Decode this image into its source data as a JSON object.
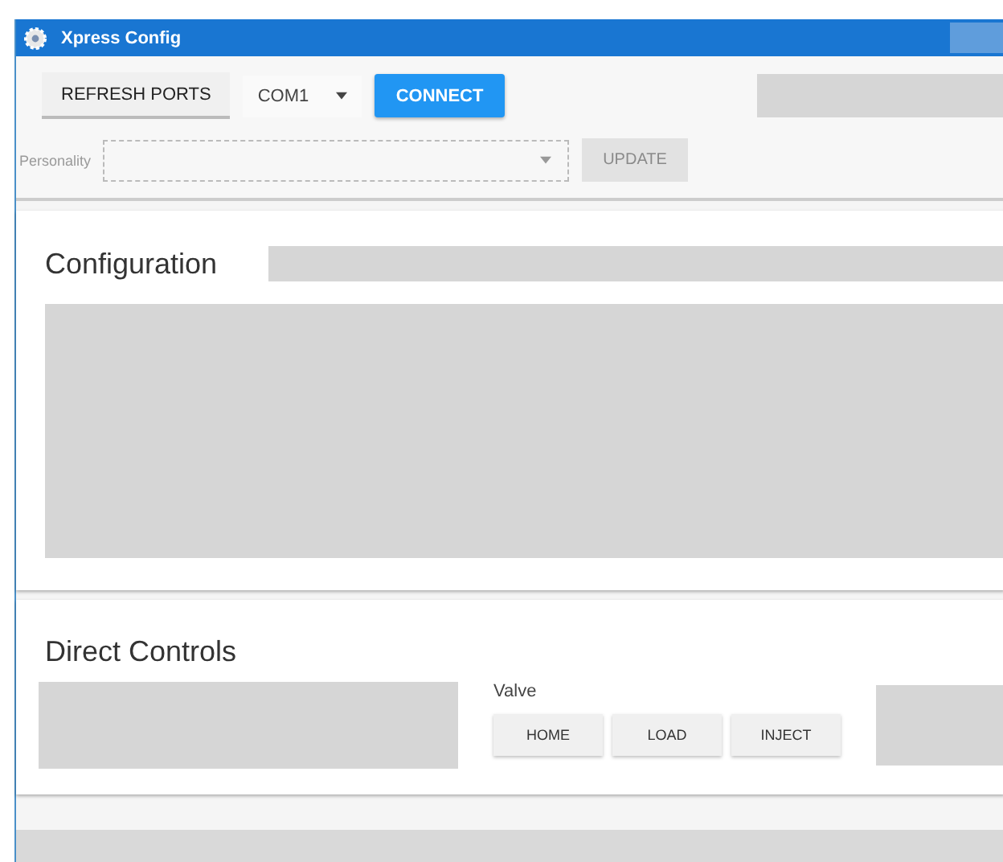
{
  "window": {
    "title": "Xpress Config"
  },
  "toolbar": {
    "refresh_button": "REFRESH PORTS",
    "port": {
      "value": "COM1"
    },
    "connect_button": "CONNECT",
    "personality": {
      "label": "Personality",
      "disabled": true
    },
    "update_button": {
      "label": "UPDATE",
      "disabled": true
    }
  },
  "configuration": {
    "title": "Configuration"
  },
  "direct_controls": {
    "title": "Direct Controls",
    "valve": {
      "label": "Valve",
      "buttons": [
        "HOME",
        "LOAD",
        "INJECT"
      ]
    }
  }
}
